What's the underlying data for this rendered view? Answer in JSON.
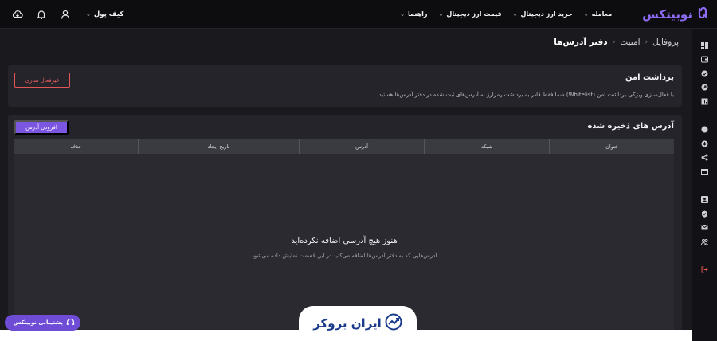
{
  "topbar": {
    "logo_text": "نوبیتکس",
    "nav": [
      {
        "label": "معامله"
      },
      {
        "label": "خرید ارز دیجیتال"
      },
      {
        "label": "قیمت ارز دیجیتال"
      },
      {
        "label": "راهنما"
      }
    ],
    "wallet_label": "کیف پول",
    "icons": [
      "download-icon",
      "bell-icon",
      "user-icon"
    ]
  },
  "breadcrumb": {
    "items": [
      "پروفایل",
      "امنیت",
      "دفتر آدرس‌ها"
    ]
  },
  "safe_withdraw": {
    "title": "برداشت امن",
    "description": "با فعال‌سازی ویژگی برداشت امن (Whitelist) شما فقط قادر به برداشت رمزارز به آدرس‌های ثبت شده در دفتر آدرس‌ها هستید.",
    "deactivate_label": "غیرفعال سازی"
  },
  "saved_addresses": {
    "title": "آدرس های ذخیره شده",
    "add_label": "افزودن آدرس",
    "columns": [
      "عنوان",
      "شبکه",
      "آدرس",
      "تاریخ ایجاد",
      "حذف"
    ],
    "empty_title": "هنوز هیچ آدرسی اضافه نکرده‌اید",
    "empty_desc": "آدرس‌هایی که به دفتر آدرس‌ها اضافه می‌کنید در این قسمت نمایش داده می‌شود"
  },
  "support_label": "پشتیبانی نوبیتکس",
  "watermark_text": "ایران بروکر",
  "colors": {
    "accent": "#7b56e0",
    "danger": "#e25656",
    "background": "#1a1a1e",
    "panel": "#24242a"
  }
}
